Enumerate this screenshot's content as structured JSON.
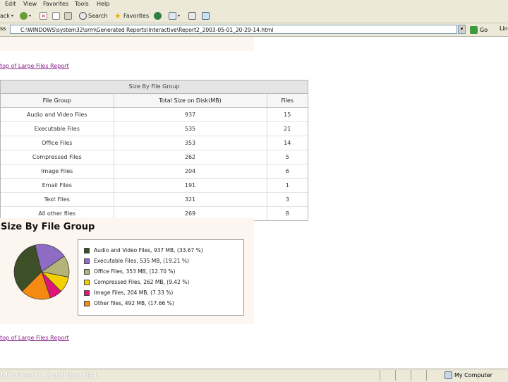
{
  "menu": {
    "edit": "Edit",
    "view": "View",
    "favorites": "Favorites",
    "tools": "Tools",
    "help": "Help"
  },
  "toolbar": {
    "back": "ack",
    "search": "Search",
    "favorites": "Favorites"
  },
  "address": {
    "label": "ss",
    "url": "C:\\WINDOWS\\system32\\srm\\Generated Reports\\Interactive\\Report2_2003-05-01_20-29-14.html",
    "go": "Go",
    "links": "Lin"
  },
  "links": {
    "top": "top of Large Files Report",
    "bottom": "top of Large Files Report"
  },
  "table": {
    "caption": "Size By File Group",
    "headers": [
      "File Group",
      "Total Size on Disk(MB)",
      "Files"
    ],
    "rows": [
      {
        "group": "Audio and Video Files",
        "size": "937",
        "files": "15"
      },
      {
        "group": "Executable Files",
        "size": "535",
        "files": "21"
      },
      {
        "group": "Office Files",
        "size": "353",
        "files": "14"
      },
      {
        "group": "Compressed Files",
        "size": "262",
        "files": "5"
      },
      {
        "group": "Image Files",
        "size": "204",
        "files": "6"
      },
      {
        "group": "Email Files",
        "size": "191",
        "files": "1"
      },
      {
        "group": "Text Files",
        "size": "321",
        "files": "3"
      },
      {
        "group": "All other files",
        "size": "269",
        "files": "8"
      }
    ]
  },
  "chart_data": {
    "type": "pie",
    "title": "Size By File Group",
    "slices": [
      {
        "label": "Audio and Video Files, 937 MB, (33.67 %)",
        "value": 33.67,
        "color": "#3d4f27"
      },
      {
        "label": "Executable Files, 535 MB, (19.21 %)",
        "value": 19.21,
        "color": "#8e6bc4"
      },
      {
        "label": "Office Files, 353 MB, (12.70 %)",
        "value": 12.7,
        "color": "#b3b37a"
      },
      {
        "label": "Compressed Files, 262 MB, (9.42 %)",
        "value": 9.42,
        "color": "#f2d000"
      },
      {
        "label": "Image Files, 204 MB, (7.33 %)",
        "value": 7.33,
        "color": "#e0157a"
      },
      {
        "label": "Other files, 492 MB, (17.66 %)",
        "value": 17.66,
        "color": "#f58a10"
      }
    ],
    "legend_position": "right"
  },
  "status": {
    "left": "Microsoft Confidential",
    "zone": "My Computer"
  }
}
